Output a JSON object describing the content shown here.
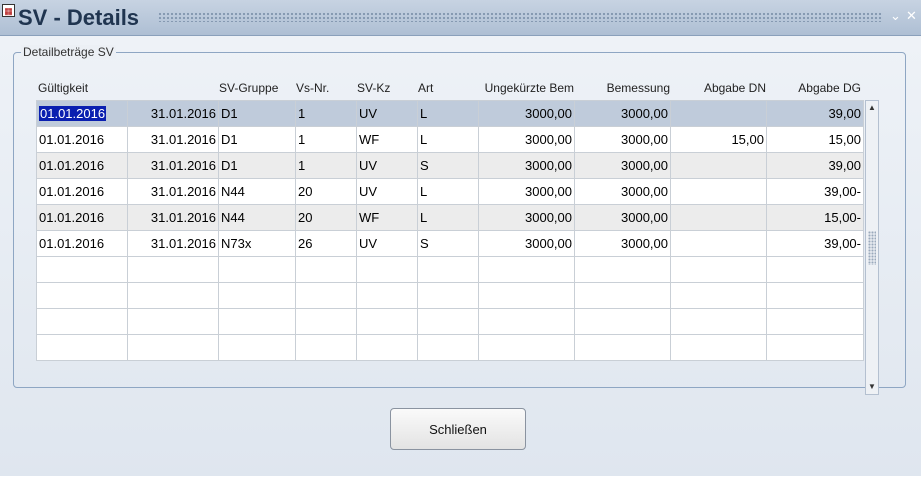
{
  "window": {
    "title": "SV - Details",
    "icon": "app-window-icon",
    "minimize_glyph": "⌄",
    "close_glyph": "✕"
  },
  "group": {
    "label": "Detailbeträge SV"
  },
  "columns": [
    "Gültigkeit",
    "SV-Gruppe",
    "Vs-Nr.",
    "SV-Kz",
    "Art",
    "Ungekürzte Bem",
    "Bemessung",
    "Abgabe DN",
    "Abgabe DG"
  ],
  "rows": [
    [
      "01.01.2016",
      "31.01.2016",
      "D1",
      "1",
      "UV",
      "L",
      "3000,00",
      "3000,00",
      "",
      "39,00"
    ],
    [
      "01.01.2016",
      "31.01.2016",
      "D1",
      "1",
      "WF",
      "L",
      "3000,00",
      "3000,00",
      "15,00",
      "15,00"
    ],
    [
      "01.01.2016",
      "31.01.2016",
      "D1",
      "1",
      "UV",
      "S",
      "3000,00",
      "3000,00",
      "",
      "39,00"
    ],
    [
      "01.01.2016",
      "31.01.2016",
      "N44",
      "20",
      "UV",
      "L",
      "3000,00",
      "3000,00",
      "",
      "39,00-"
    ],
    [
      "01.01.2016",
      "31.01.2016",
      "N44",
      "20",
      "WF",
      "L",
      "3000,00",
      "3000,00",
      "",
      "15,00-"
    ],
    [
      "01.01.2016",
      "31.01.2016",
      "N73x",
      "26",
      "UV",
      "S",
      "3000,00",
      "3000,00",
      "",
      "39,00-"
    ],
    [
      "",
      "",
      "",
      "",
      "",
      "",
      "",
      "",
      "",
      ""
    ],
    [
      "",
      "",
      "",
      "",
      "",
      "",
      "",
      "",
      "",
      ""
    ],
    [
      "",
      "",
      "",
      "",
      "",
      "",
      "",
      "",
      "",
      ""
    ],
    [
      "",
      "",
      "",
      "",
      "",
      "",
      "",
      "",
      "",
      ""
    ]
  ],
  "buttons": {
    "close_label": "Schließen"
  },
  "colors": {
    "titlebar": "#aebfd4",
    "selected_row": "#bfcbdb",
    "focused_cell": "#0a1fb0"
  }
}
